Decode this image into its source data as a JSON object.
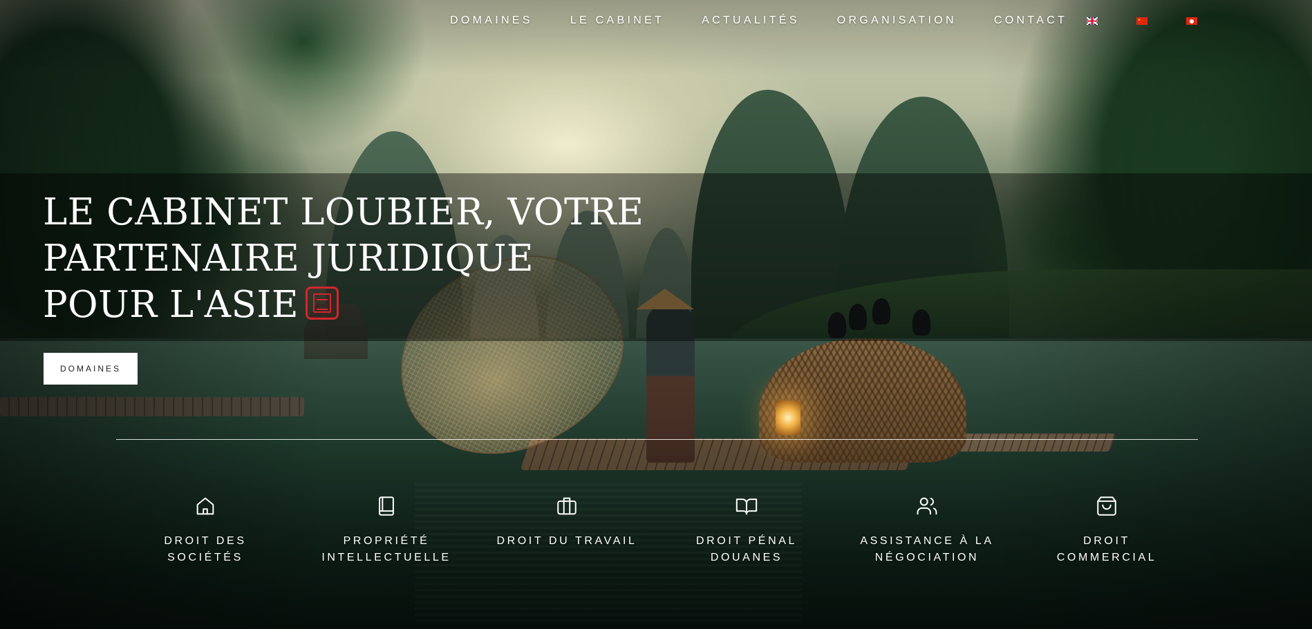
{
  "nav": {
    "links": [
      "DOMAINES",
      "LE CABINET",
      "ACTUALITÉS",
      "ORGANISATION",
      "CONTACT"
    ],
    "languages": [
      {
        "icon": "uk-flag-icon",
        "colors": [
          "#012169",
          "#ffffff",
          "#cf142b"
        ]
      },
      {
        "icon": "china-flag-icon",
        "colors": [
          "#de2910",
          "#ffde00"
        ]
      },
      {
        "icon": "hong-kong-flag-icon",
        "colors": [
          "#de2910",
          "#ffffff"
        ]
      }
    ]
  },
  "hero": {
    "title_lines": [
      "LE CABINET LOUBIER, VOTRE",
      "PARTENAIRE JURIDIQUE",
      "POUR L'ASIE"
    ],
    "seal_icon": "red-seal-icon",
    "cta_label": "DOMAINES"
  },
  "practice_areas": [
    {
      "icon": "home-icon",
      "lines": [
        "DROIT DES",
        "SOCIÉTÉS"
      ]
    },
    {
      "icon": "book-icon",
      "lines": [
        "PROPRIÉTÉ",
        "INTELLECTUELLE"
      ]
    },
    {
      "icon": "briefcase-icon",
      "lines": [
        "DROIT DU TRAVAIL"
      ]
    },
    {
      "icon": "open-book-icon",
      "lines": [
        "DROIT PÉNAL",
        "DOUANES"
      ]
    },
    {
      "icon": "users-icon",
      "lines": [
        "ASSISTANCE À LA",
        "NÉGOCIATION"
      ]
    },
    {
      "icon": "shopping-bag-icon",
      "lines": [
        "DROIT",
        "COMMERCIAL"
      ]
    }
  ],
  "colors": {
    "seal_red": "#d2272c",
    "button_bg": "#ffffff",
    "button_text": "#1d1d1d",
    "text": "#ffffff"
  }
}
